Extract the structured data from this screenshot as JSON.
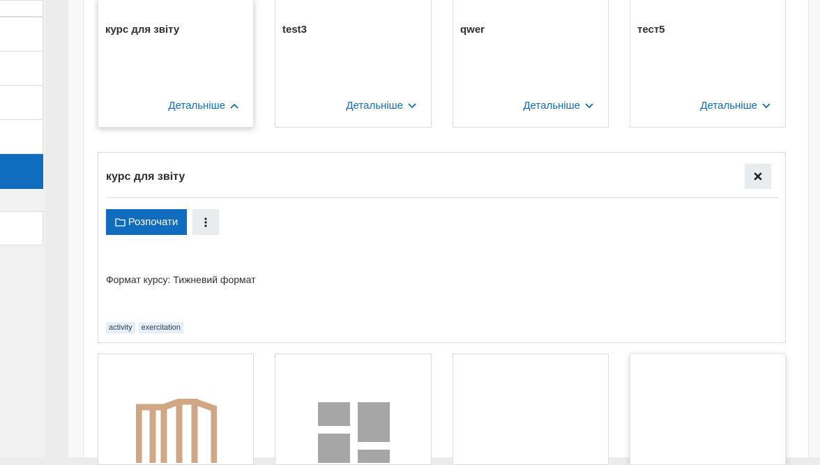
{
  "courses": [
    {
      "title": "курс для звіту",
      "more_label": "Детальніше",
      "expanded": true
    },
    {
      "title": "test3",
      "more_label": "Детальніше",
      "expanded": false
    },
    {
      "title": "qwer",
      "more_label": "Детальніше",
      "expanded": false
    },
    {
      "title": "тест5",
      "more_label": "Детальніше",
      "expanded": false
    }
  ],
  "detail": {
    "title": "курс для звіту",
    "start_label": "Розпочати",
    "format_text": "Формат курсу: Тижневий формат",
    "tags": [
      "activity",
      "exercitation"
    ]
  },
  "colors": {
    "primary": "#0f6cbf",
    "button_grey": "#e9ecef",
    "tag_bg": "#e8eef6",
    "thumbnail_tan": "#cfa784",
    "thumbnail_grey": "#a6a6a6"
  },
  "icons": {
    "expand_up": "chevron-up-icon",
    "expand_down": "chevron-down-icon",
    "close": "close-icon",
    "start": "folder-icon",
    "menu": "kebab-menu-icon"
  }
}
